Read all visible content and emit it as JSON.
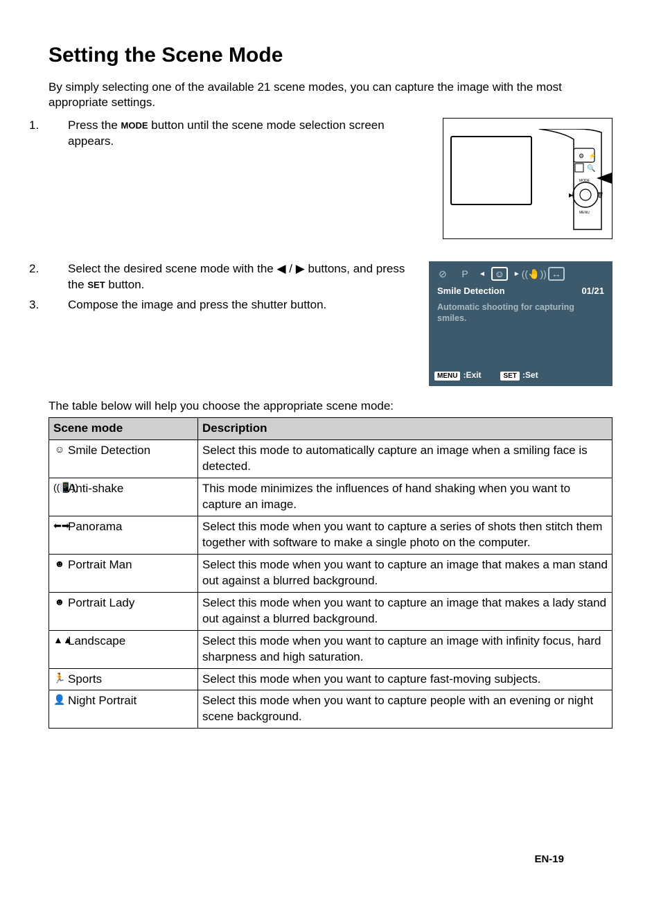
{
  "heading": "Setting the Scene Mode",
  "intro": "By simply selecting one of the available 21 scene modes, you can capture the image with the most appropriate settings.",
  "steps": {
    "s1a": "Press the ",
    "s1_mode": "MODE",
    "s1b": " button until the scene mode selection screen appears.",
    "s2a": "Select the desired scene mode with the ◀ / ▶ buttons, and press the ",
    "s2_set": "SET",
    "s2b": " button.",
    "s3": "Compose the image and press the shutter button."
  },
  "lcd": {
    "title": "Smile Detection",
    "counter": "01/21",
    "desc": "Automatic shooting for capturing smiles.",
    "menu_btn": "MENU",
    "menu_label": ":Exit",
    "set_btn": "SET",
    "set_label": ":Set"
  },
  "table_intro": "The table below will help you choose the appropriate scene mode:",
  "table": {
    "h1": "Scene mode",
    "h2": "Description",
    "rows": [
      {
        "icon": "☺",
        "name": "Smile Detection",
        "desc": "Select this mode to automatically capture an image when a smiling face is detected."
      },
      {
        "icon": "((📳))",
        "name": "Anti-shake",
        "desc": "This mode minimizes the influences of hand shaking when you want to capture an image."
      },
      {
        "icon": "⬅➡",
        "name": "Panorama",
        "desc": "Select this mode when you want to capture a series of shots then stitch them together with software to make a single photo on the computer."
      },
      {
        "icon": "☻",
        "name": "Portrait Man",
        "desc": "Select this mode when you want to capture an image that makes a man stand out against a blurred background."
      },
      {
        "icon": "☻",
        "name": "Portrait Lady",
        "desc": "Select this mode when you want to capture an image that makes a lady stand out against a blurred background."
      },
      {
        "icon": "▲▲",
        "name": "Landscape",
        "desc": "Select this mode when you want to capture an image with infinity focus, hard sharpness and high saturation."
      },
      {
        "icon": "🏃",
        "name": "Sports",
        "desc": "Select this mode when you want to capture fast-moving subjects."
      },
      {
        "icon": "👤",
        "name": "Night Portrait",
        "desc": "Select this mode when you want to capture people with an evening or night scene background."
      }
    ]
  },
  "page_num": "EN-19"
}
